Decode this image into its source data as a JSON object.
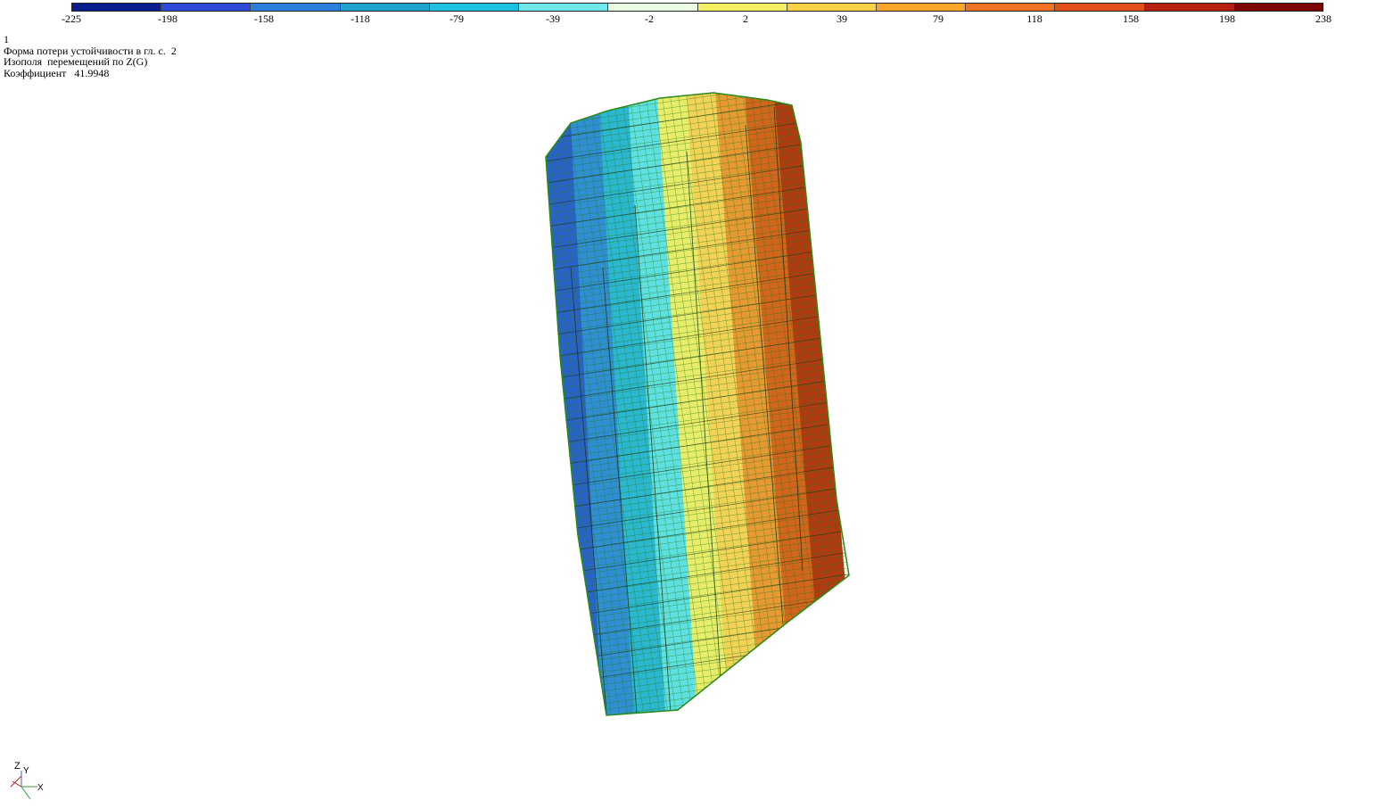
{
  "legend": {
    "colors": [
      "#0a1f8f",
      "#2f49d8",
      "#2e7fdc",
      "#1fa3cc",
      "#1fc0e0",
      "#6fe8ea",
      "#e9fbe2",
      "#f4ef62",
      "#f8d043",
      "#f7a62a",
      "#ef7322",
      "#e2501c",
      "#b3220f",
      "#7e0707"
    ],
    "ticks": [
      "-225",
      "-198",
      "-158",
      "-118",
      "-79",
      "-39",
      "-2",
      "2",
      "39",
      "79",
      "118",
      "158",
      "198",
      "238"
    ]
  },
  "info": {
    "line1": "1",
    "line2": "Форма потери устойчивости в гл. с.  2",
    "line3": "Изополя  перемещений по Z(G)",
    "line4": "Коэффициент   41.9948"
  },
  "axes": {
    "z": "Z",
    "y": "Y",
    "x": "X"
  },
  "model": {
    "bands": [
      "#2a63c8",
      "#2f8fd2",
      "#2bb7cf",
      "#5fe0e0",
      "#e7ec6a",
      "#f2d257",
      "#e79a33",
      "#d2661d",
      "#b13a12"
    ],
    "mesh_color": "#1f7a12"
  }
}
